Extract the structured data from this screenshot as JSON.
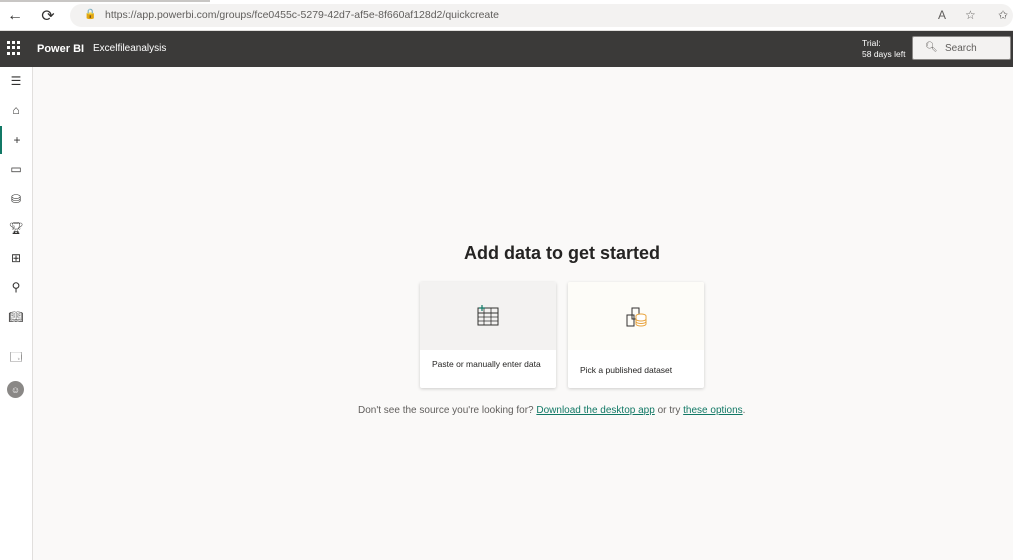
{
  "browser": {
    "url": "https://app.powerbi.com/groups/fce0455c-5279-42d7-af5e-8f660af128d2/quickcreate",
    "back_icon": "back-arrow-icon",
    "reload_icon": "reload-icon"
  },
  "header": {
    "brand": "Power BI",
    "workspace": "Excelfileanalysis",
    "trial_line1": "Trial:",
    "trial_line2": "58 days left",
    "search_placeholder": "Search"
  },
  "sidebar": {
    "items": [
      {
        "name": "menu-icon"
      },
      {
        "name": "home-icon"
      },
      {
        "name": "create-icon"
      },
      {
        "name": "browse-icon"
      },
      {
        "name": "data-hub-icon"
      },
      {
        "name": "goals-icon"
      },
      {
        "name": "apps-icon"
      },
      {
        "name": "metrics-icon"
      },
      {
        "name": "learn-icon"
      },
      {
        "name": "workspaces-icon"
      }
    ]
  },
  "main": {
    "title": "Add data to get started",
    "card1_label": "Paste or manually enter data",
    "card2_label": "Pick a published dataset",
    "note_prefix": "Don't see the source you're looking for?",
    "note_link1": "Download the desktop app",
    "note_mid": "or try",
    "note_link2": "these options",
    "note_suffix": "."
  },
  "colors": {
    "accent": "#117865",
    "header_bg": "#3b3a39",
    "dataset_icon": "#e8a33d"
  }
}
